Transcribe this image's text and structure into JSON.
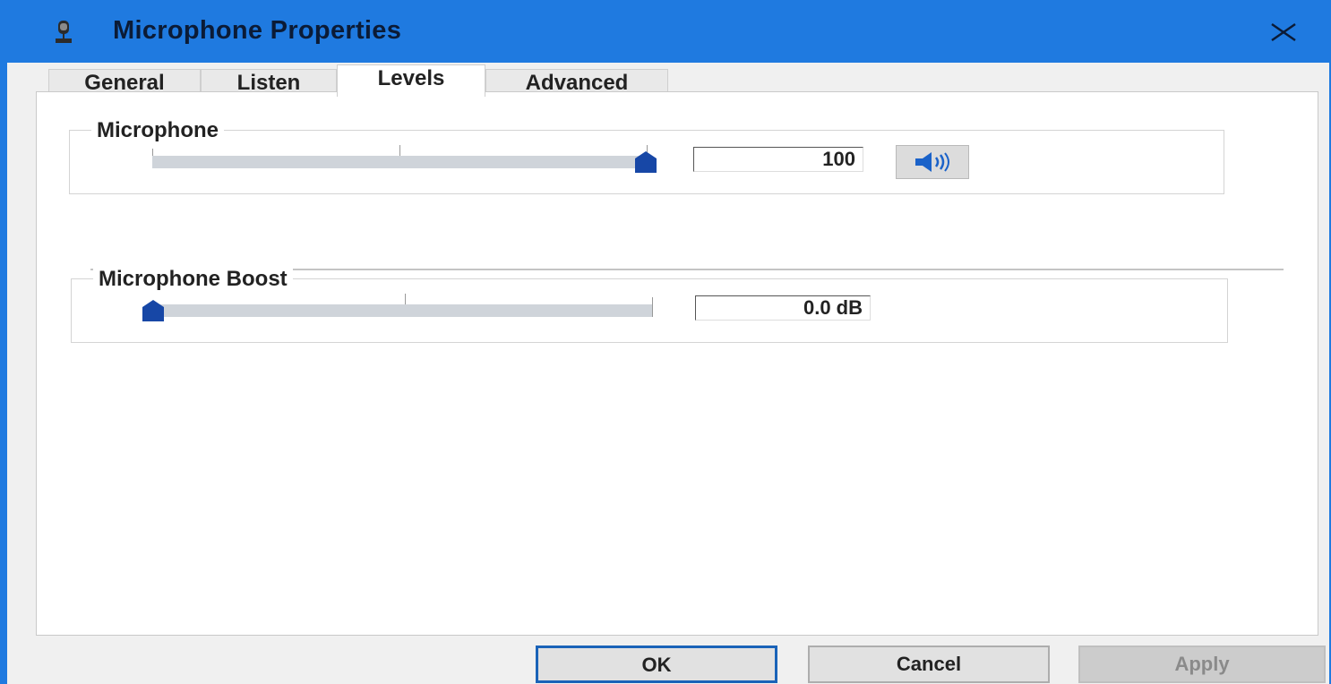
{
  "window": {
    "title": "Microphone Properties",
    "title_icon": "microphone-icon",
    "close_icon": "close-icon",
    "accent": "#1f7ae0"
  },
  "tabs": [
    {
      "label": "General",
      "active": false
    },
    {
      "label": "Listen",
      "active": false
    },
    {
      "label": "Levels",
      "active": true
    },
    {
      "label": "Advanced",
      "active": false
    }
  ],
  "microphone": {
    "label": "Microphone",
    "value": "100",
    "level": 1.0,
    "mute_icon": "speaker-icon"
  },
  "boost": {
    "label": "Microphone Boost",
    "value": "0.0 dB",
    "level": 0.0
  },
  "buttons": {
    "ok": "OK",
    "cancel": "Cancel",
    "apply": "Apply"
  }
}
